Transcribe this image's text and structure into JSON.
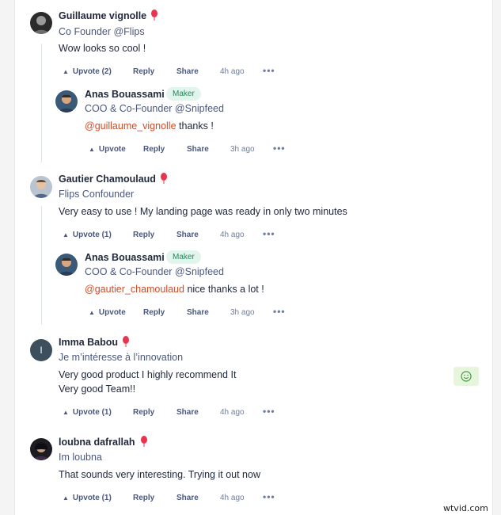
{
  "comments": [
    {
      "name": "Guillaume vignolle",
      "headline": "Co Founder @Flips",
      "text": "Wow looks so cool !",
      "upvote": "Upvote (2)",
      "reply": "Reply",
      "share": "Share",
      "time": "4h ago",
      "reply_comment": {
        "name": "Anas Bouassami",
        "badge": "Maker",
        "headline": "COO & Co-Founder @Snipfeed",
        "mention": "@guillaume_vignolle",
        "text": " thanks !",
        "upvote": "Upvote",
        "reply": "Reply",
        "share": "Share",
        "time": "3h ago"
      }
    },
    {
      "name": "Gautier Chamoulaud",
      "headline": "Flips Confounder",
      "text": "Very easy to use ! My landing page was ready in only two minutes",
      "upvote": "Upvote (1)",
      "reply": "Reply",
      "share": "Share",
      "time": "4h ago",
      "reply_comment": {
        "name": "Anas Bouassami",
        "badge": "Maker",
        "headline": "COO & Co-Founder @Snipfeed",
        "mention": "@gautier_chamoulaud",
        "text": " nice thanks a lot !",
        "upvote": "Upvote",
        "reply": "Reply",
        "share": "Share",
        "time": "3h ago"
      }
    },
    {
      "name": "Imma Babou",
      "avatar_letter": "I",
      "headline": "Je m’intéresse à l’innovation",
      "text_line1": "Very good product I highly recommend It",
      "text_line2": "Very good Team!!",
      "upvote": "Upvote (1)",
      "reply": "Reply",
      "share": "Share",
      "time": "4h ago"
    },
    {
      "name": "loubna dafrallah",
      "headline": "Im loubna",
      "text": "That sounds very interesting. Trying it out now",
      "upvote": "Upvote (1)",
      "reply": "Reply",
      "share": "Share",
      "time": "4h ago"
    }
  ],
  "icons": {
    "upvote": "triangle-up-icon",
    "more": "more-dots-icon",
    "balloon": "balloon-icon",
    "emoji": "smiley-icon"
  },
  "colors": {
    "mention": "#cc4d29",
    "maker_badge_bg": "#e1f5ec",
    "maker_badge_text": "#1f8a5a",
    "balloon": "#e8344e"
  },
  "watermark": "wtvid.com"
}
